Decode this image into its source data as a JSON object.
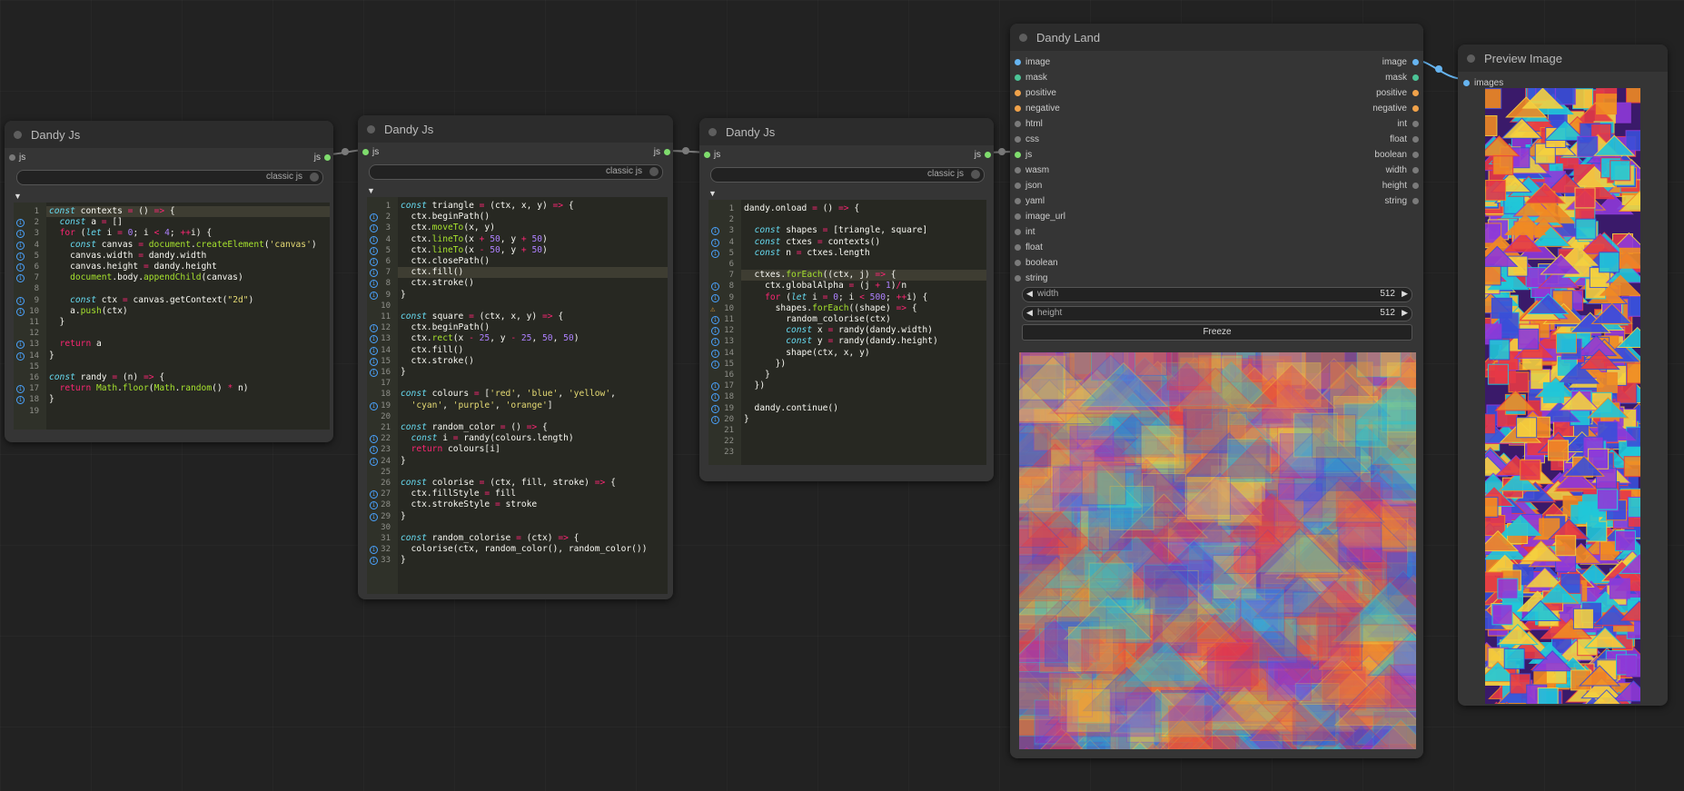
{
  "nodes": {
    "js1": {
      "title": "Dandy Js",
      "in": "js",
      "out": "js",
      "mode": "classic js",
      "lines": [
        "const contexts = () => {",
        "  const a = []",
        "  for (let i = 0; i < 4; ++i) {",
        "    const canvas = document.createElement('canvas')",
        "    canvas.width = dandy.width",
        "    canvas.height = dandy.height",
        "    document.body.appendChild(canvas)",
        "",
        "    const ctx = canvas.getContext(\"2d\")",
        "    a.push(ctx)",
        "  }",
        "",
        "  return a",
        "}",
        "",
        "const randy = (n) => {",
        "  return Math.floor(Math.random() * n)",
        "}",
        ""
      ]
    },
    "js2": {
      "title": "Dandy Js",
      "in": "js",
      "out": "js",
      "mode": "classic js",
      "lines": [
        "const triangle = (ctx, x, y) => {",
        "  ctx.beginPath()",
        "  ctx.moveTo(x, y)",
        "  ctx.lineTo(x + 50, y + 50)",
        "  ctx.lineTo(x - 50, y + 50)",
        "  ctx.closePath()",
        "  ctx.fill()",
        "  ctx.stroke()",
        "}",
        "",
        "const square = (ctx, x, y) => {",
        "  ctx.beginPath()",
        "  ctx.rect(x - 25, y - 25, 50, 50)",
        "  ctx.fill()",
        "  ctx.stroke()",
        "}",
        "",
        "const colours = ['red', 'blue', 'yellow',",
        "  'cyan', 'purple', 'orange']",
        "",
        "const random_color = () => {",
        "  const i = randy(colours.length)",
        "  return colours[i]",
        "}",
        "",
        "const colorise = (ctx, fill, stroke) => {",
        "  ctx.fillStyle = fill",
        "  ctx.strokeStyle = stroke",
        "}",
        "",
        "const random_colorise = (ctx) => {",
        "  colorise(ctx, random_color(), random_color())",
        "}"
      ]
    },
    "js3": {
      "title": "Dandy Js",
      "in": "js",
      "out": "js",
      "mode": "classic js",
      "lines": [
        "dandy.onload = () => {",
        "",
        "  const shapes = [triangle, square]",
        "  const ctxes = contexts()",
        "  const n = ctxes.length",
        "",
        "  ctxes.forEach((ctx, j) => {",
        "    ctx.globalAlpha = (j + 1)/n",
        "    for (let i = 0; i < 500; ++i) {",
        "      shapes.forEach((shape) => {",
        "        random_colorise(ctx)",
        "        const x = randy(dandy.width)",
        "        const y = randy(dandy.height)",
        "        shape(ctx, x, y)",
        "      })",
        "    }",
        "  })",
        "",
        "  dandy.continue()",
        "}",
        "",
        "",
        ""
      ]
    },
    "land": {
      "title": "Dandy Land",
      "inputs": [
        "image",
        "mask",
        "positive",
        "negative",
        "html",
        "css",
        "js",
        "wasm",
        "json",
        "yaml",
        "image_url",
        "int",
        "float",
        "boolean",
        "string"
      ],
      "outputs": [
        "image",
        "mask",
        "positive",
        "negative",
        "int",
        "float",
        "boolean",
        "width",
        "height",
        "string"
      ],
      "width_label": "width",
      "width_value": "512",
      "height_label": "height",
      "height_value": "512",
      "freeze_label": "Freeze"
    },
    "preview": {
      "title": "Preview Image",
      "input": "images"
    }
  },
  "colors": {
    "canvas": "#222222",
    "node": "#353535",
    "title": "#2c2c2c",
    "editor": "#272822",
    "pin_js": "#7fdc6d",
    "pin_image": "#66b4f0",
    "pin_mask": "#4cc497",
    "pin_cond": "#f0a24a"
  }
}
